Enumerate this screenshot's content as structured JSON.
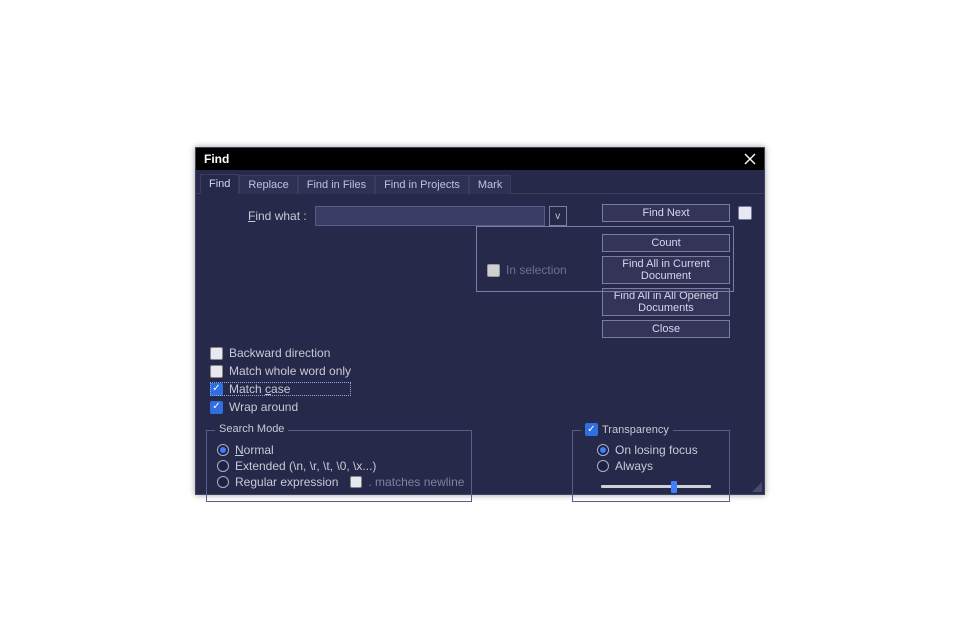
{
  "title": "Find",
  "tabs": {
    "find": "Find",
    "replace": "Replace",
    "find_in_files": "Find in Files",
    "find_in_projects": "Find in Projects",
    "mark": "Mark"
  },
  "find_what": {
    "label_pre": "F",
    "label_post": "ind what :",
    "value": "",
    "dropdown_glyph": "v"
  },
  "buttons": {
    "find_next": "Find Next",
    "count": "Count",
    "find_all_current": "Find All in Current Document",
    "find_all_opened": "Find All in All Opened Documents",
    "close": "Close"
  },
  "in_selection_label": "In selection",
  "options": {
    "backward": "Backward direction",
    "whole_word": "Match whole word only",
    "match_case_pre": "Match ",
    "match_case_u": "c",
    "match_case_post": "ase",
    "wrap": "Wrap around"
  },
  "search_mode": {
    "legend": "Search Mode",
    "normal_u": "N",
    "normal_post": "ormal",
    "extended": "Extended (\\n, \\r, \\t, \\0, \\x...)",
    "regex": "Regular expression",
    "matches_newline": ". matches newline"
  },
  "transparency": {
    "legend": "Transparency",
    "on_losing_focus": "On losing focus",
    "always": "Always",
    "slider_value": 64
  }
}
